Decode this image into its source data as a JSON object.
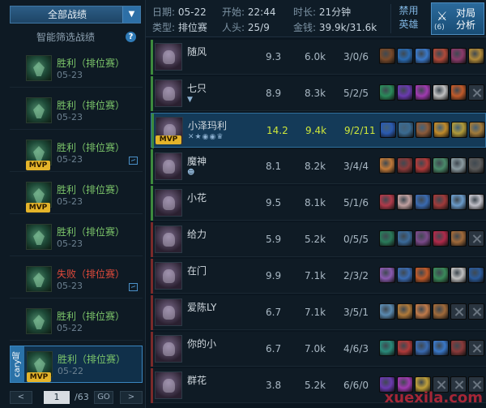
{
  "sidebar": {
    "filter_main": "全部战绩",
    "filter_smart": "智能筛选战绩",
    "help": "?",
    "matches": [
      {
        "result": "胜利（排位赛）",
        "date": "05-23",
        "outcome": "win",
        "mvp": false,
        "screenshot": false
      },
      {
        "result": "胜利（排位赛）",
        "date": "05-23",
        "outcome": "win",
        "mvp": false,
        "screenshot": false
      },
      {
        "result": "胜利（排位赛）",
        "date": "05-23",
        "outcome": "win",
        "mvp": true,
        "screenshot": true
      },
      {
        "result": "胜利（排位赛）",
        "date": "05-23",
        "outcome": "win",
        "mvp": true,
        "screenshot": false
      },
      {
        "result": "胜利（排位赛）",
        "date": "05-23",
        "outcome": "win",
        "mvp": false,
        "screenshot": false
      },
      {
        "result": "失败（排位赛）",
        "date": "05-23",
        "outcome": "lose",
        "mvp": false,
        "screenshot": true
      },
      {
        "result": "胜利（排位赛）",
        "date": "05-22",
        "outcome": "win",
        "mvp": false,
        "screenshot": false
      },
      {
        "result": "胜利（排位赛）",
        "date": "05-22",
        "outcome": "win",
        "mvp": true,
        "screenshot": false,
        "carry": "cary局",
        "selected": true
      }
    ],
    "mvp_label": "MVP",
    "pager": {
      "prev": "<",
      "page": "1",
      "total": "/63",
      "go": "GO",
      "next": ">"
    }
  },
  "header": {
    "date_label": "日期:",
    "date": "05-22",
    "start_label": "开始:",
    "start": "22:44",
    "duration_label": "时长:",
    "duration": "21分钟",
    "type_label": "类型:",
    "type": "排位赛",
    "kills_label": "人头:",
    "kills": "25/9",
    "gold_label": "金钱:",
    "gold": "39.9k/31.6k",
    "ban_line1": "禁用",
    "ban_line2": "英雄",
    "analysis_count": "(6)",
    "analysis_line1": "对局",
    "analysis_line2": "分析"
  },
  "players": [
    {
      "team": "blue",
      "name": "随风",
      "score": "9.3",
      "gold": "6.0k",
      "kda": "3/0/6",
      "items": [
        "#7a4a2a",
        "#2a6ab0",
        "#3a78c8",
        "#b04a3a",
        "#8a3a6a",
        "#b08a3a"
      ]
    },
    {
      "team": "blue",
      "name": "七只",
      "badges": "▼",
      "score": "8.9",
      "gold": "8.3k",
      "kda": "5/2/5",
      "items": [
        "#2a8a5a",
        "#6a3ab0",
        "#a03ab0",
        "#c0c0c0",
        "#c05a2a",
        "empty"
      ]
    },
    {
      "team": "blue",
      "name": "小泽玛利",
      "me": true,
      "mvp": true,
      "badges": "✕★◉◉♛",
      "score": "14.2",
      "gold": "9.4k",
      "kda": "9/2/11",
      "items": [
        "#2a5ab0",
        "#3a6a90",
        "#8a5a3a",
        "#c08a2a",
        "#b09a3a",
        "#a07a3a"
      ]
    },
    {
      "team": "blue",
      "name": "魔神",
      "badges": "☻",
      "score": "8.1",
      "gold": "8.2k",
      "kda": "3/4/4",
      "items": [
        "#c07a3a",
        "#8a3a3a",
        "#b03a3a",
        "#4a8a6a",
        "#8a9aa0",
        "#5a5a5a"
      ]
    },
    {
      "team": "blue",
      "name": "小花",
      "score": "9.5",
      "gold": "8.1k",
      "kda": "5/1/6",
      "items": [
        "#b03a4a",
        "#c0a0a0",
        "#3a6ab0",
        "#a03a3a",
        "#6a9ac8",
        "#c0c0c8"
      ]
    },
    {
      "team": "red",
      "name": "给力",
      "score": "5.9",
      "gold": "5.2k",
      "kda": "0/5/5",
      "items": [
        "#2a7a5a",
        "#3a6a9a",
        "#7a4a8a",
        "#b02a4a",
        "#a06a3a",
        "empty"
      ]
    },
    {
      "team": "red",
      "name": "在门",
      "score": "9.9",
      "gold": "7.1k",
      "kda": "2/3/2",
      "items": [
        "#8a5ab0",
        "#3a6ab0",
        "#c05a2a",
        "#3a8a5a",
        "#c0c0c0",
        "#2a5a9a"
      ]
    },
    {
      "team": "red",
      "name": "爱陈LY",
      "score": "6.7",
      "gold": "7.1k",
      "kda": "3/5/1",
      "items": [
        "#5a8ab0",
        "#b07a3a",
        "#c07a4a",
        "#a06a3a",
        "empty",
        "empty"
      ]
    },
    {
      "team": "red",
      "name": "你的小",
      "score": "6.7",
      "gold": "7.0k",
      "kda": "4/6/3",
      "items": [
        "#2a8a7a",
        "#b03a3a",
        "#3a6ab0",
        "#3a78c8",
        "#8a3a3a",
        "empty"
      ]
    },
    {
      "team": "red",
      "name": "群花",
      "score": "3.8",
      "gold": "5.2k",
      "kda": "6/6/0",
      "items": [
        "#6a3ab0",
        "#a03ab0",
        "#c0a03a",
        "empty",
        "empty",
        "empty"
      ]
    }
  ],
  "watermark": "xuexila.com"
}
